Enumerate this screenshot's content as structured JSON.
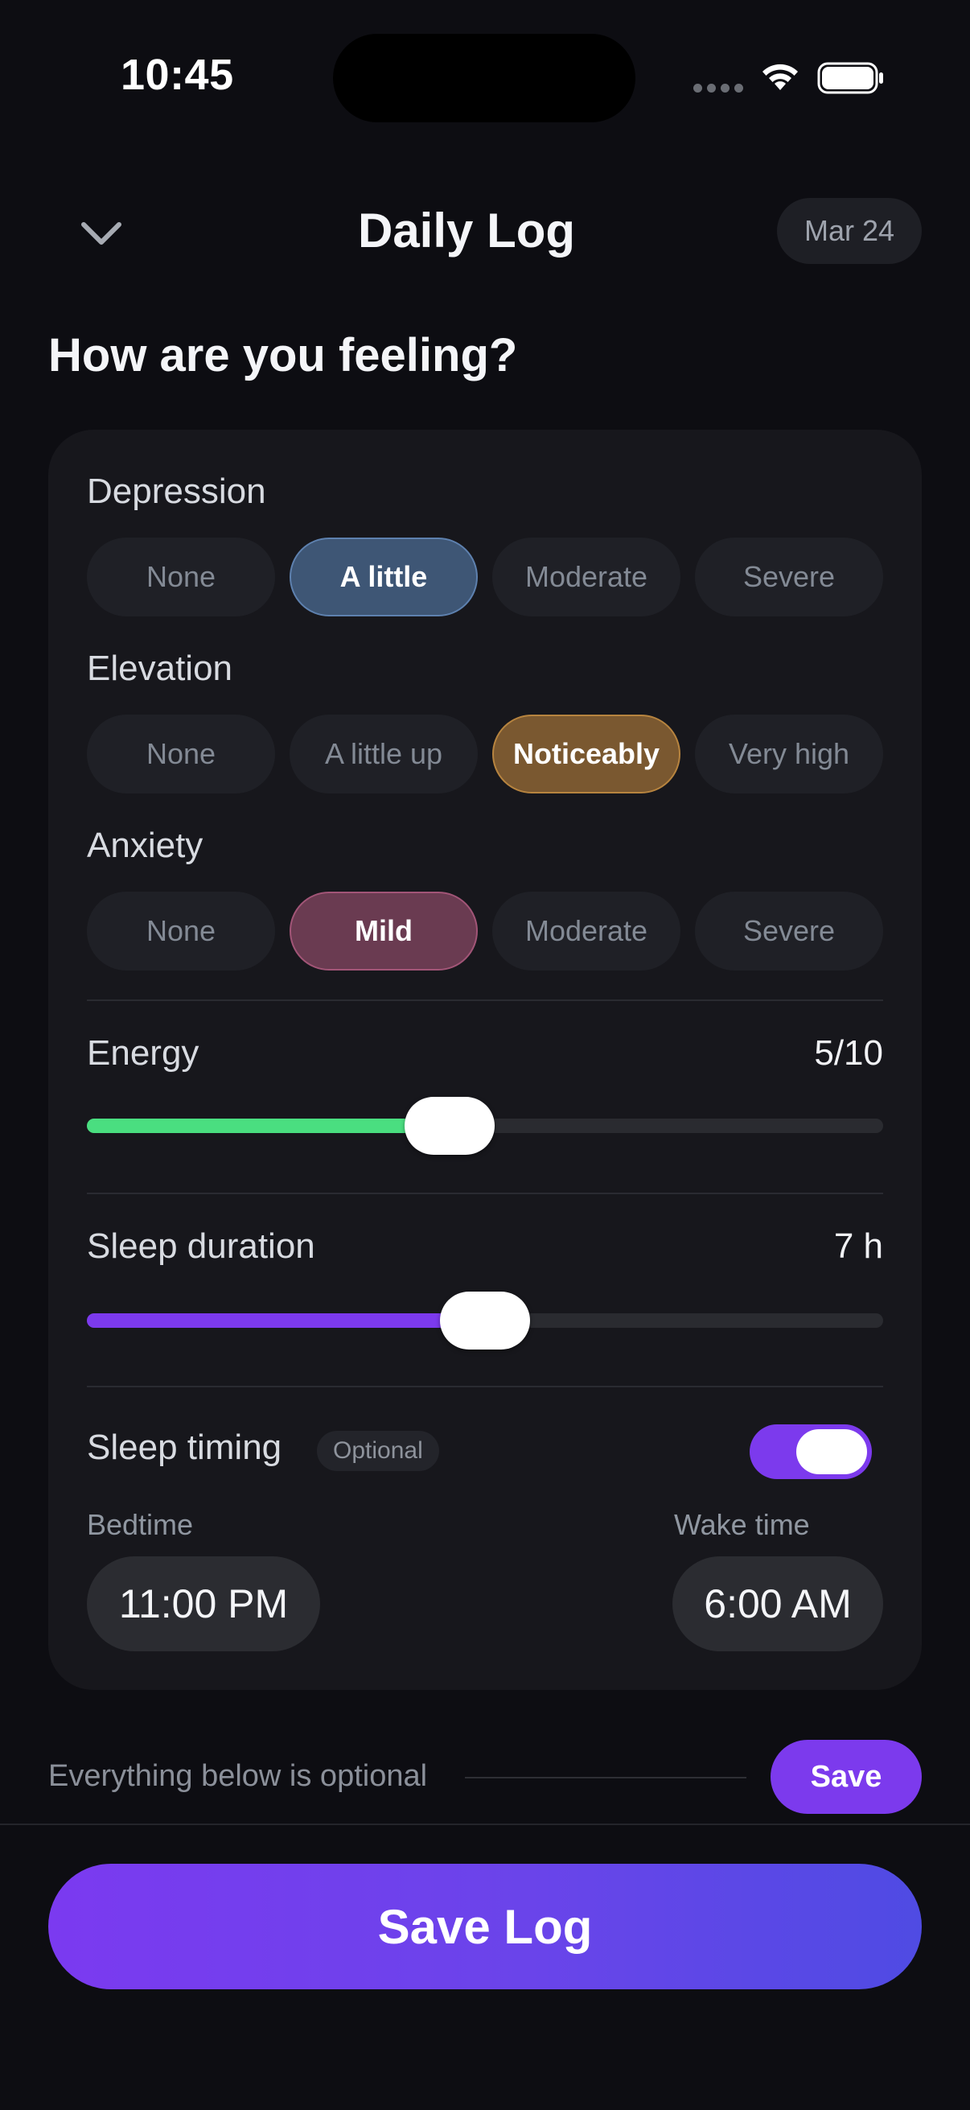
{
  "status_bar": {
    "time": "10:45"
  },
  "header": {
    "title": "Daily Log",
    "date": "Mar 24"
  },
  "heading": "How are you feeling?",
  "groups": [
    {
      "label": "Depression",
      "options": [
        "None",
        "A little",
        "Moderate",
        "Severe"
      ],
      "selected": "A little"
    },
    {
      "label": "Elevation",
      "options": [
        "None",
        "A little up",
        "Noticeably",
        "Very high"
      ],
      "selected": "Noticeably"
    },
    {
      "label": "Anxiety",
      "options": [
        "None",
        "Mild",
        "Moderate",
        "Severe"
      ],
      "selected": "Mild"
    }
  ],
  "energy": {
    "label": "Energy",
    "value": "5/10",
    "level": 0.45,
    "color": "#4ade80"
  },
  "sleep_duration": {
    "label": "Sleep duration",
    "value": "7 h",
    "level": 0.5,
    "color": "#7c3aed"
  },
  "sleep_timing": {
    "label": "Sleep timing",
    "badge": "Optional",
    "enabled": true,
    "bedtime_label": "Bedtime",
    "bedtime": "11:00 PM",
    "wake_label": "Wake time",
    "wake": "6:00 AM"
  },
  "footer": {
    "optional_note": "Everything below is optional",
    "save_label": "Save",
    "save_log_label": "Save Log"
  },
  "colors": {
    "accent": "#7c3aed",
    "background": "#0d0d12",
    "card": "#17171c"
  }
}
